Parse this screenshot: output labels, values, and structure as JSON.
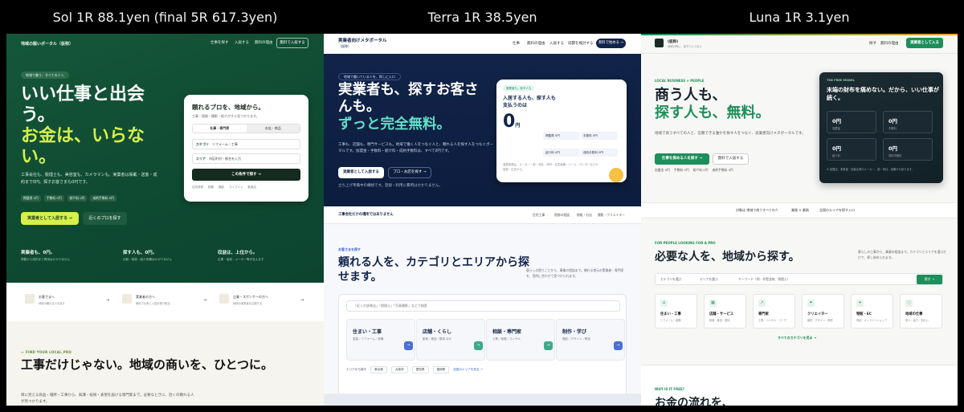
{
  "captions": {
    "sol": "Sol 1R 88.1yen (final 5R 617.3yen)",
    "terra": "Terra 1R 38.5yen",
    "luna": "Luna 1R 3.1yen"
  },
  "sol": {
    "brand": "地域の賑いポータル（仮称）",
    "nav": [
      "仕事を探す",
      "入居する",
      "無料の理由"
    ],
    "nav_cta": "無料で入居する",
    "pill": "地域で働う、すべての人へ",
    "h1_white": "いい仕事と出会う。",
    "h1_accent": "お金は、いらない。",
    "para": "工事会社も、税理士も、美容室も、カメラマンも。実業者は掲載・送客・成約まで0円。探すお客さまも0円です。",
    "tags": [
      "掲載費 0円",
      "手数料 0円",
      "紹介料 0円",
      "成約手数料 0円"
    ],
    "cta_primary": "実業者として入居する →",
    "cta_secondary": "近くのプロを探す",
    "card": {
      "title": "頼れるプロを、地域から。",
      "sub": "工事・税務・撮影・紹介がすぐ見つかります。",
      "tabs": [
        "仕事・専門家",
        "お店・商品"
      ],
      "row1_label": "カテゴリ",
      "row1_value": "リフォーム・工事",
      "row2_label": "エリア",
      "row2_value": "市区町村・駅名を入力",
      "search_button": "この条件で探す →",
      "chips": [
        "住宅改修",
        "税務",
        "撮影",
        "ライブイン",
        "飲食店"
      ]
    },
    "stats": [
      {
        "t": "実業者も、0円。",
        "s": "掲載から成約まで費用はかかりません"
      },
      {
        "t": "探す人も、0円。",
        "s": "比較・相談・紹介依頼はかかりません"
      },
      {
        "t": "収益は、上位から。",
        "s": "企業・協賛・メーカー等が支えます"
      }
    ],
    "links": [
      {
        "t": "お客さまへ",
        "s": "地域の頼れる人を探す"
      },
      {
        "t": "実業者の方へ",
        "s": "無料で仕事と入居を受け取る"
      },
      {
        "t": "企業・スポンサーの方へ",
        "s": "地域の実業者を応援する"
      }
    ],
    "label": "— FIND YOUR LOCAL PRO",
    "h2": "工事だけじゃない。地域の商いを、ひとつに。",
    "p2": "目に見える商品・場所・工事から、知識・技術・表現を届ける専門家まで。必要なときに、近くの頼れる人が見つかります。"
  },
  "terra": {
    "brand": "実業者向けメタポータル",
    "brand_sub": "（仮称）",
    "nav": [
      "仕事",
      "無料の理由",
      "入居する",
      "協賛を検討する"
    ],
    "nav_cta": "無料で始める →",
    "pill": "地域で働いている人を、探しに入口",
    "h1_white": "実業者も、探すお客さんも。",
    "h1_accent": "ずっと完全無料。",
    "para": "工事も、店舗も、専門サービスも。地域で働く人をつなぐ人と、頼れる人を探す人をつなぐポータルです。加盟金・手数料・紹介料・成約手数料は、すべて0円です。",
    "cta_primary": "実業者として入居する",
    "cta_secondary": "プロ・お店を探す →",
    "note": "立ち上げ準備中の構想です。登録・利用に費用はかかりません。",
    "card": {
      "badge": "実業者も、探す人も",
      "title": "入居する人も、探す人も支払うのは",
      "big": "0",
      "unit": "円",
      "cells": [
        "掲載費 0円",
        "手数料 0円",
        "紹介料 0円",
        "成約手数料 0円"
      ],
      "foot": "運営財源は、メーカー・卸・商社・資材・住宅設備・ツール・ベンダーなどの協賛・広告から。"
    },
    "strip_title": "工事会社だけの場所ではありません",
    "strip_items": [
      "住宅工事",
      "税務の相談",
      "物販・お店",
      "撮影・クリエイター"
    ],
    "label": "お客さまを探す",
    "h2": "頼れる人を、カテゴリとエリアから探せます。",
    "p2": "暮らしの困りごとから、事業の相談まで。頼れる地元の実業者・専門家を、目的に合わせて見つけられます。",
    "search_placeholder": "「近くの塗装店」「税理士」「写真撮影」などで検索",
    "cats": [
      {
        "n": "住まい・工事",
        "s": "塗装／リフォーム／設備",
        "c": "#4a6fd6"
      },
      {
        "n": "店舗・くらし",
        "s": "飲食／美容／整体 ほか",
        "c": "#3ea98a"
      },
      {
        "n": "相談・専門家",
        "s": "士業／保険／コンサル",
        "c": "#3ea98a"
      },
      {
        "n": "制作・学び",
        "s": "撮影／デザイン／教室",
        "c": "#4a6fd6"
      }
    ],
    "areas_label": "エリアから探す",
    "areas": [
      "東京都",
      "大阪府",
      "愛知県",
      "福岡県"
    ],
    "areas_link": "全国のエリアを見る →"
  },
  "luna": {
    "brand": "(仮称)",
    "brand_sub": "地域の商い、探す人とつなぐ",
    "nav": [
      "探す",
      "無料の理由"
    ],
    "nav_cta": "実業者として入る",
    "label": "LOCAL BUSINESS × PEOPLE",
    "h1_dark": "商う人も、",
    "h1_green": "探す人も、無料。",
    "para": "地域で商うすべての人と、信頼できる誰かを探す人をつなぐ、実業者向けメタポータルです。",
    "cta_primary": "仕事を探める人を探す →",
    "cta_secondary": "無料で入居する",
    "tags": [
      "加盟金 0円",
      "手数料 0円",
      "紹介料 0円",
      "成約手数料 0円"
    ],
    "dcard": {
      "label": "THE FREE MODEL",
      "title": "末端の財布を痛めない。だから、いい仕事が続く。",
      "boxes": [
        {
          "b": "0円",
          "i": "加盟金"
        },
        {
          "b": "0円",
          "i": "手数料"
        },
        {
          "b": "0円",
          "i": "紹介料"
        },
        {
          "b": "0円",
          "i": "成約手数料"
        }
      ],
      "foot": "※ 加盟店、事業者・送客企業のメーカー、卸・商社、設備から回ります。"
    },
    "band": [
      "対象は 地域で商うすべての人",
      "業務 × 業務",
      "全国のエリアを探す入口"
    ],
    "label2": "FOR PEOPLE LOOKING FOR A PRO",
    "h2": "必要な人を、地域から探す。",
    "p2": "暮らしの工事から、事業の相談まで。カテゴリとエリアを選ぶだけで、探し始められます。",
    "search": [
      "カテゴリを選ぶ",
      "エリアを選ぶ",
      "キーワード（例：外壁塗装、税理士）"
    ],
    "search_btn": "探す →",
    "cats": [
      {
        "n": "住まい・工事",
        "s": "リフォーム・設備",
        "i": "⌂"
      },
      {
        "n": "店舗・サービス",
        "s": "飲食・美容・整体",
        "i": "▦"
      },
      {
        "n": "専門家",
        "s": "士業・コンサル・コーチ",
        "i": "↗"
      },
      {
        "n": "クリエイター",
        "s": "撮影・デザイン・制作",
        "i": "✦"
      },
      {
        "n": "物販・EC",
        "s": "商品・オンラインショップ",
        "i": "+"
      },
      {
        "n": "地域の仕事",
        "s": "求人・協力・手伝い",
        "i": "◌"
      }
    ],
    "all_link": "すべてのカテゴリを見る →",
    "label3": "WHY IS IT FREE?",
    "h3": "お金の流れを、"
  }
}
